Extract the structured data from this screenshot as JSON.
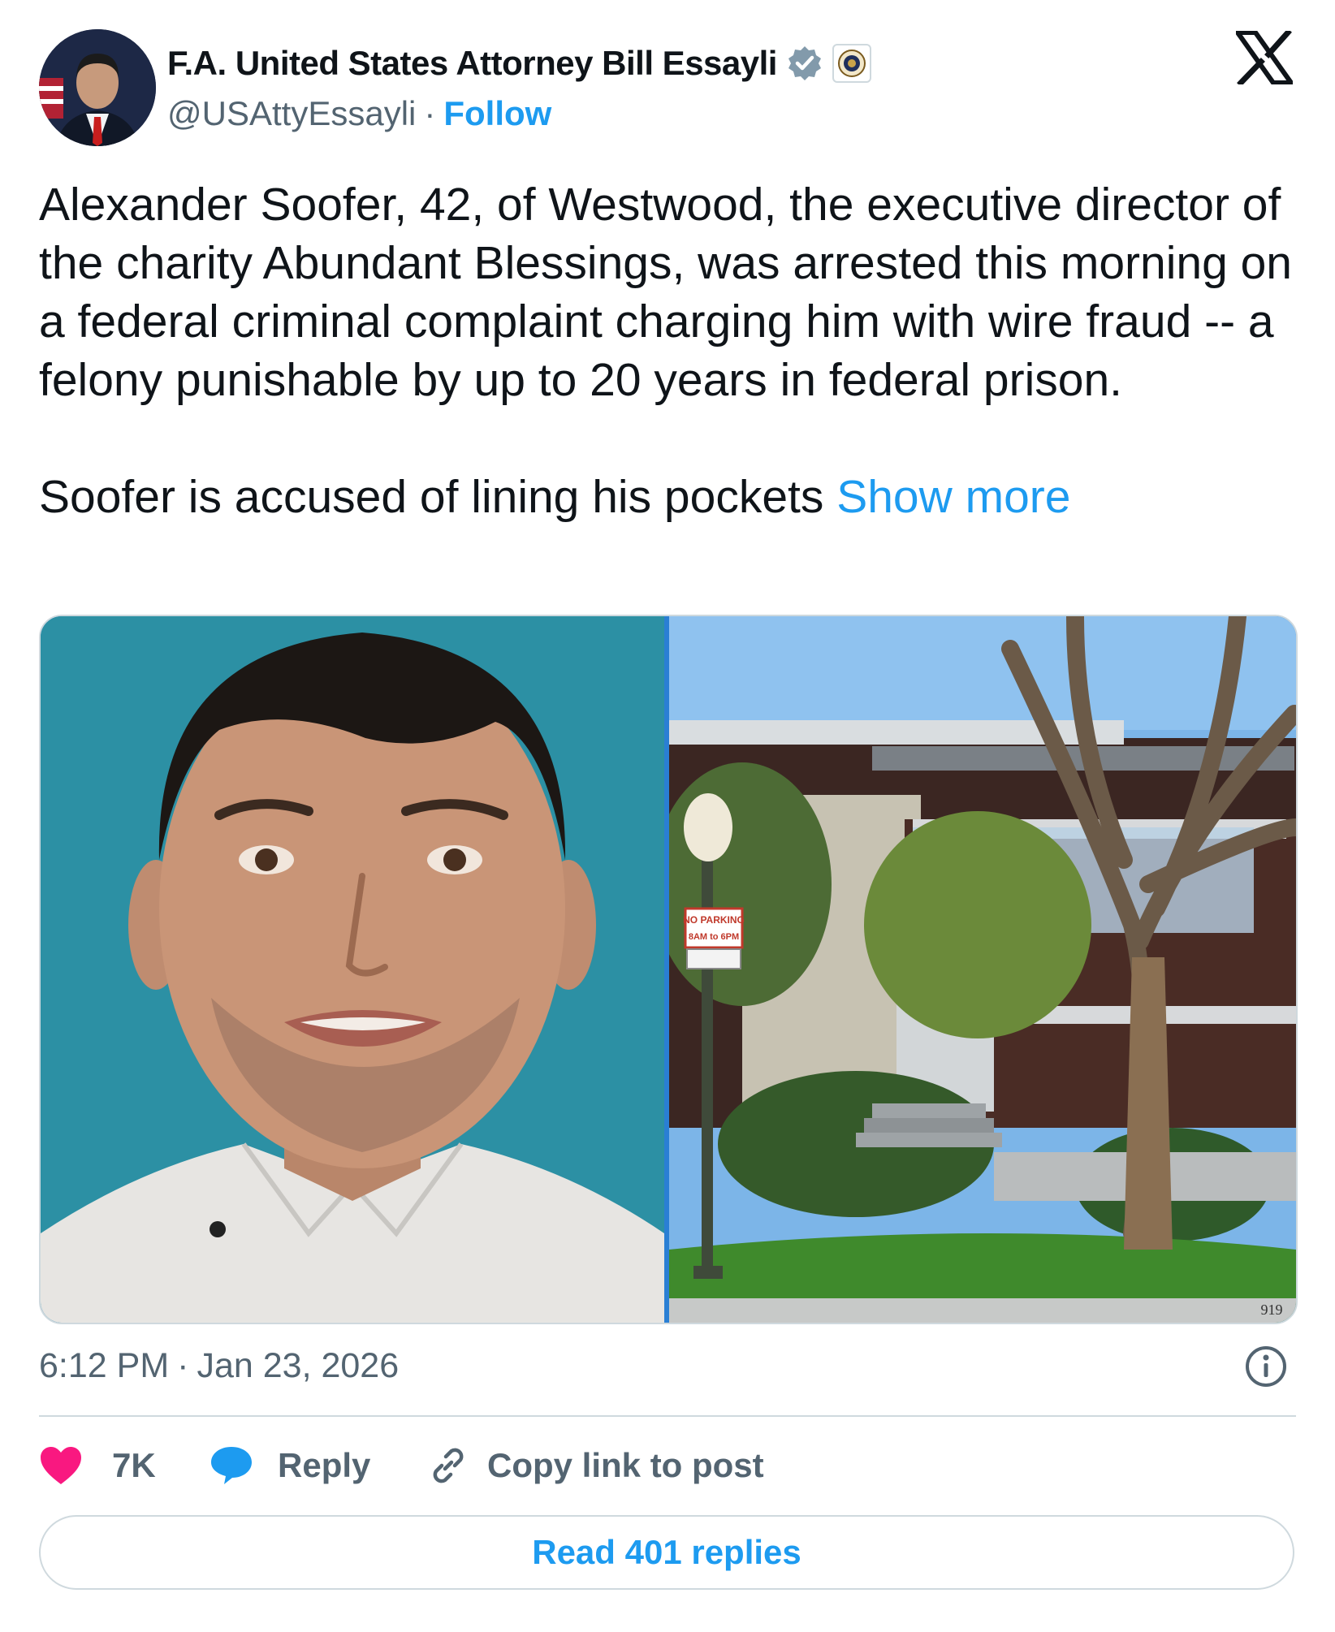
{
  "post": {
    "author": {
      "display_name": "F.A. United States Attorney Bill Essayli",
      "handle": "@USAttyEssayli",
      "separator": "·",
      "follow_label": "Follow",
      "verified_icon": "verified-badge-icon",
      "org_badge_icon": "doj-seal-icon"
    },
    "platform_logo": "x-logo-icon",
    "text_paragraph_1": "Alexander Soofer, 42, of Westwood, the executive director of the charity Abundant Blessings, was arrested this morning on a federal criminal complaint charging him with wire fraud -- a felony punishable by up to 20 years in federal prison.",
    "text_paragraph_2": "Soofer is accused of lining his pockets",
    "show_more_label": "Show more",
    "media": [
      {
        "kind": "photo",
        "description_icon": "portrait-photo"
      },
      {
        "kind": "photo",
        "description_icon": "house-photo",
        "sign_text_1": "NO PARKING",
        "sign_text_2": "8AM to 6PM",
        "address_number": "919"
      }
    ],
    "time": "6:12 PM",
    "date_separator": "·",
    "date": "Jan 23, 2026",
    "info_icon": "info-icon",
    "actions": {
      "likes_count": "7K",
      "reply_label": "Reply",
      "copy_link_label": "Copy link to post"
    },
    "read_replies_label": "Read 401 replies"
  },
  "colors": {
    "accent": "#1d9bf0",
    "like": "#f91880",
    "muted": "#536471",
    "border": "#cfd9de"
  }
}
